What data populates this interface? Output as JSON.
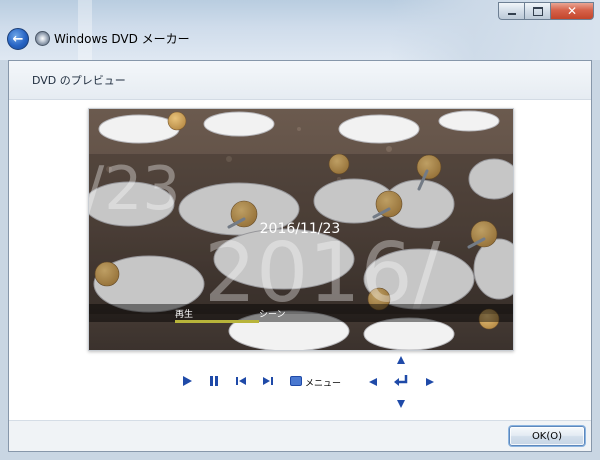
{
  "window": {
    "title": "Windows DVD メーカー",
    "colors": {
      "accent": "#1f4aa8",
      "close": "#c3452b",
      "glass": "#cfdceb"
    }
  },
  "header": {
    "heading": "DVD のプレビュー"
  },
  "preview": {
    "date_text": "2016/11/23",
    "big_date_left": "/23",
    "big_date_right": "2016/",
    "menu_items": [
      "再生",
      "シーン"
    ],
    "selected_item": "再生"
  },
  "controls": {
    "icons": [
      "play-icon",
      "pause-icon",
      "previous-icon",
      "next-icon",
      "menu-icon",
      "arrow-up-icon",
      "arrow-left-icon",
      "enter-icon",
      "arrow-right-icon",
      "arrow-down-icon"
    ],
    "menu_label": "メニュー"
  },
  "footer": {
    "ok_label": "OK(O)"
  }
}
